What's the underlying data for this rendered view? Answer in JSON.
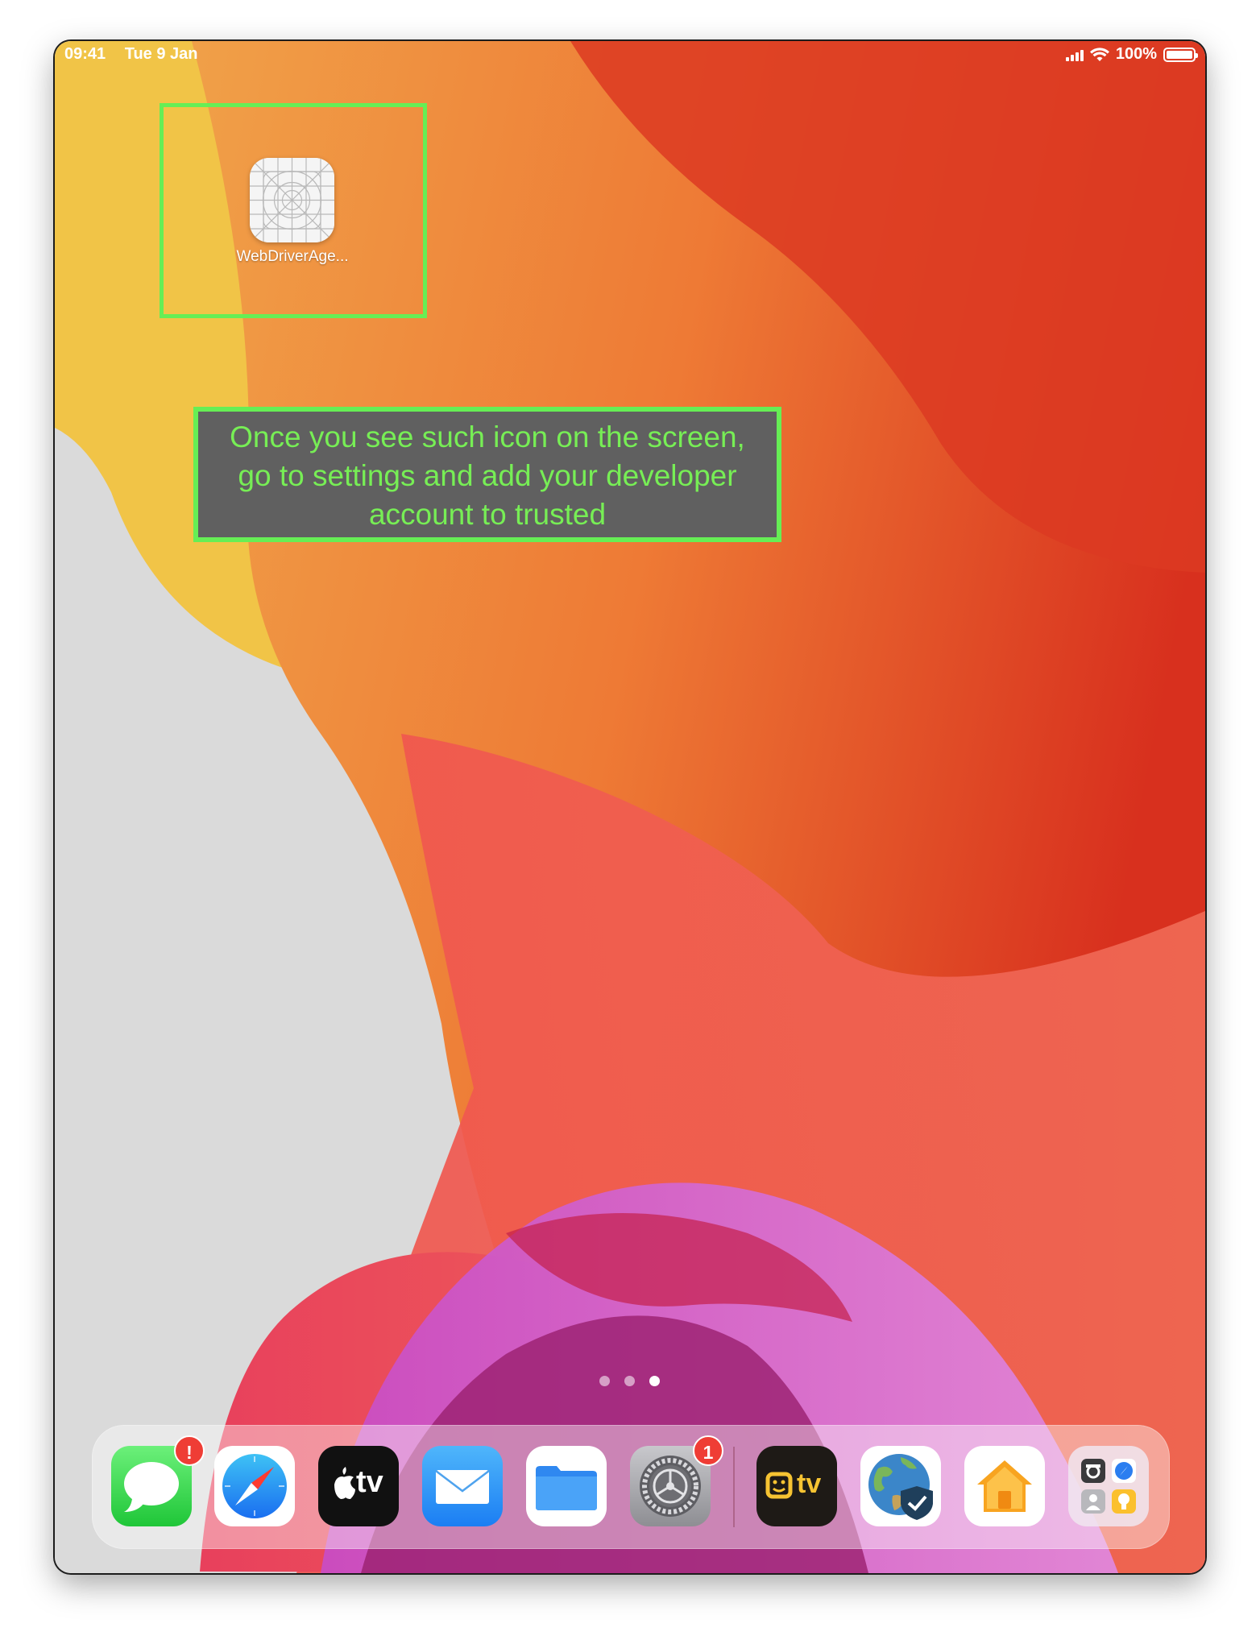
{
  "status_bar": {
    "time": "09:41",
    "date": "Tue 9 Jan",
    "battery_percent": "100%",
    "battery_level": 1.0
  },
  "home_screen": {
    "app": {
      "label": "WebDriverAge...",
      "icon": "blank-app-grid-icon"
    }
  },
  "annotation": {
    "lines": [
      "Once you see such icon on the screen,",
      "go to settings and add your developer",
      "account to trusted"
    ]
  },
  "page_indicator": {
    "count": 3,
    "active": 3
  },
  "dock": {
    "apps": [
      {
        "name": "messages-icon",
        "badge": "!"
      },
      {
        "name": "safari-icon",
        "badge": ""
      },
      {
        "name": "apple-tv-icon",
        "badge": ""
      },
      {
        "name": "mail-icon",
        "badge": ""
      },
      {
        "name": "files-icon",
        "badge": ""
      },
      {
        "name": "settings-icon",
        "badge": "1"
      },
      {
        "name": "tv-app-icon",
        "badge": ""
      },
      {
        "name": "globe-vpn-icon",
        "badge": ""
      },
      {
        "name": "home-icon",
        "badge": ""
      },
      {
        "name": "app-folder-icon",
        "badge": ""
      }
    ],
    "labels": {
      "apple_tv_text": "tv",
      "tv_app_text": "tv"
    }
  },
  "colors": {
    "highlight": "#66ee55",
    "callout_bg": "#606060",
    "badge": "#ef3d35"
  }
}
